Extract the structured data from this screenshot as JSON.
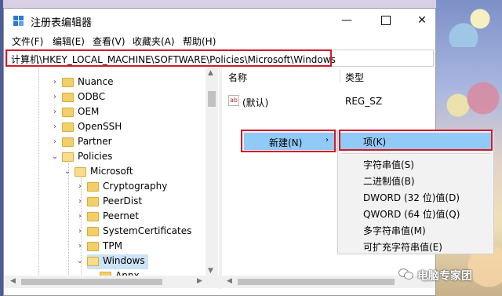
{
  "window": {
    "title": "注册表编辑器",
    "minimize": "—",
    "close": "✕"
  },
  "menu": [
    "文件(F)",
    "编辑(E)",
    "查看(V)",
    "收藏夹(A)",
    "帮助(H)"
  ],
  "address": "计算机\\HKEY_LOCAL_MACHINE\\SOFTWARE\\Policies\\Microsoft\\Windows",
  "tree": [
    {
      "label": "Nuance",
      "expanded": false
    },
    {
      "label": "ODBC",
      "expanded": false
    },
    {
      "label": "OEM",
      "expanded": false
    },
    {
      "label": "OpenSSH",
      "expanded": false
    },
    {
      "label": "Partner",
      "expanded": false
    },
    {
      "label": "Policies",
      "expanded": true
    },
    {
      "label": "Microsoft",
      "expanded": true
    },
    {
      "label": "Cryptography",
      "expanded": false
    },
    {
      "label": "PeerDist",
      "expanded": false
    },
    {
      "label": "Peernet",
      "expanded": false
    },
    {
      "label": "SystemCertificates",
      "expanded": false
    },
    {
      "label": "TPM",
      "expanded": false
    },
    {
      "label": "Windows",
      "expanded": true,
      "selected": true
    },
    {
      "label": "Appx",
      "expanded": false
    }
  ],
  "list": {
    "columns": [
      "名称",
      "类型"
    ],
    "rows": [
      {
        "name": "(默认)",
        "type": "REG_SZ",
        "icon": "ab-string-icon"
      }
    ]
  },
  "context_menu": {
    "new_label": "新建(N)",
    "new_arrow": "›"
  },
  "submenu": {
    "key_label": "项(K)",
    "items": [
      "字符串值(S)",
      "二进制值(B)",
      "DWORD (32 位)值(D)",
      "QWORD (64 位)值(Q)",
      "多字符串值(M)",
      "可扩充字符串值(E)"
    ]
  },
  "watermark": "电脑专家团",
  "colors": {
    "highlight_border": "#d11a2a",
    "menu_hover": "#91c9f7",
    "selection": "#cce4f7"
  }
}
